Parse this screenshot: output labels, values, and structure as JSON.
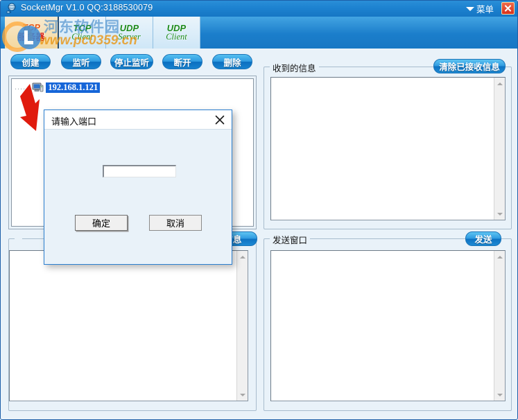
{
  "window": {
    "title": "SocketMgr V1.0  QQ:3188530079",
    "app_icon": "satellite-icon",
    "menu_label": "菜单",
    "close_label": "×"
  },
  "tabs": [
    {
      "line1": "TCP",
      "line2": "服务器",
      "active": true,
      "name": "tab-tcp-server"
    },
    {
      "line1": "TCP",
      "line2": "Client",
      "active": false,
      "name": "tab-tcp-client"
    },
    {
      "line1": "UDP",
      "line2": "Server",
      "active": false,
      "name": "tab-udp-server"
    },
    {
      "line1": "UDP",
      "line2": "Client",
      "active": false,
      "name": "tab-udp-client"
    }
  ],
  "watermark": {
    "cn_text": "河东软件园",
    "url_text": "www.pc0359.cn"
  },
  "toolbar": {
    "buttons": [
      {
        "label": "创建",
        "name": "create-button"
      },
      {
        "label": "监听",
        "name": "listen-button"
      },
      {
        "label": "停止监听",
        "name": "stop-listen-button"
      },
      {
        "label": "断开",
        "name": "disconnect-button"
      },
      {
        "label": "删除",
        "name": "delete-button"
      }
    ]
  },
  "left": {
    "tree": {
      "dots": "......",
      "item_label": "192.168.1.121",
      "icon": "computer-icon"
    },
    "lower_group_button": "信息"
  },
  "right": {
    "received": {
      "legend": "收到的信息",
      "clear_button": "清除已接收信息",
      "textarea_value": ""
    },
    "send": {
      "legend": "发送窗口",
      "send_button": "发送",
      "textarea_value": ""
    }
  },
  "dialog": {
    "title": "请输入端口",
    "close_label": "×",
    "input_value": "",
    "input_placeholder": "",
    "ok_label": "确定",
    "cancel_label": "取消"
  },
  "colors": {
    "titlebar": "#1d82d0",
    "accent": "#2f9ae0",
    "background": "#e9f2f9",
    "selection": "#1565d8",
    "close_red": "#d8301a",
    "annotation_arrow": "#e01b0e",
    "tab_active_text": "#d81f10",
    "tab_text": "#1c8a1c"
  }
}
